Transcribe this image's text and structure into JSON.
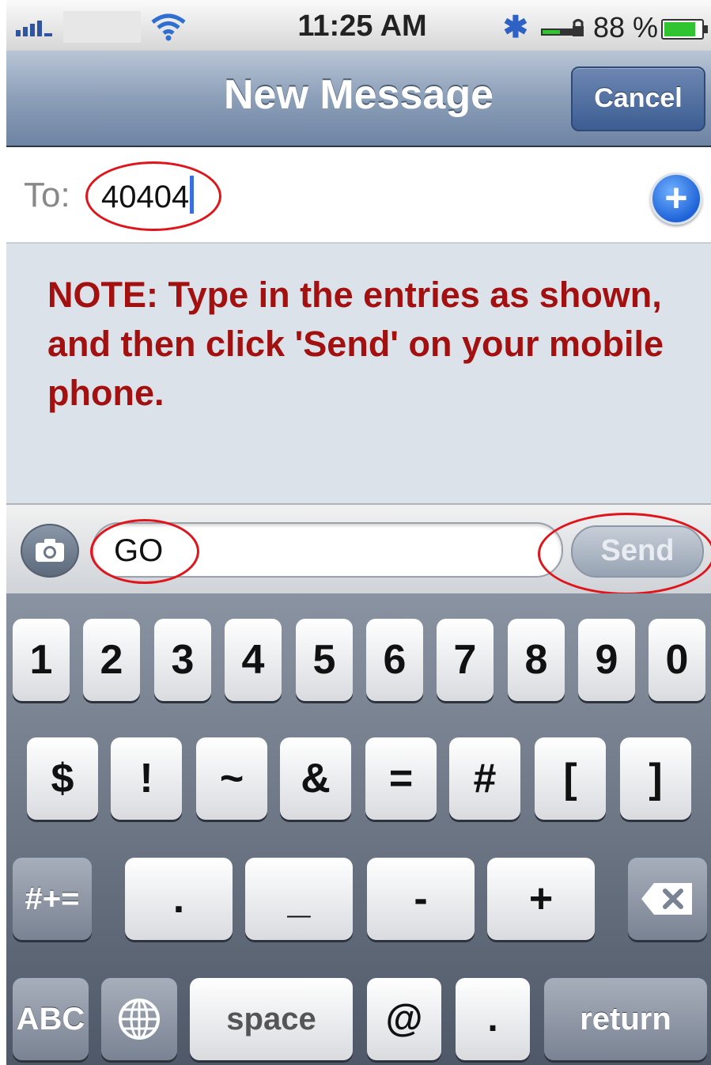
{
  "status_bar": {
    "time": "11:25 AM",
    "battery_percent": "88 %",
    "battery_level": 0.88,
    "icons": [
      "signal-icon",
      "wifi-icon",
      "bluetooth-icon",
      "lock-icon",
      "battery-icon"
    ]
  },
  "nav": {
    "title": "New Message",
    "cancel_label": "Cancel"
  },
  "recipient": {
    "label": "To:",
    "value": "40404"
  },
  "note": "NOTE: Type in the entries as shown, and then click 'Send' on your mobile phone.",
  "compose": {
    "value": "GO",
    "send_label": "Send"
  },
  "keyboard": {
    "row1": [
      "1",
      "2",
      "3",
      "4",
      "5",
      "6",
      "7",
      "8",
      "9",
      "0"
    ],
    "row2": [
      "$",
      "!",
      "~",
      "&",
      "=",
      "#",
      "[",
      "]"
    ],
    "row3_left": "#+=",
    "row3": [
      ".",
      "_",
      "-",
      "+"
    ],
    "row4_left": "ABC",
    "space_label": "space",
    "at_label": "@",
    "dot_label": ".",
    "return_label": "return"
  },
  "colors": {
    "note_text": "#a31010",
    "highlight_ellipse": "#e0141b",
    "nav_bar": "#8c9fb8"
  }
}
